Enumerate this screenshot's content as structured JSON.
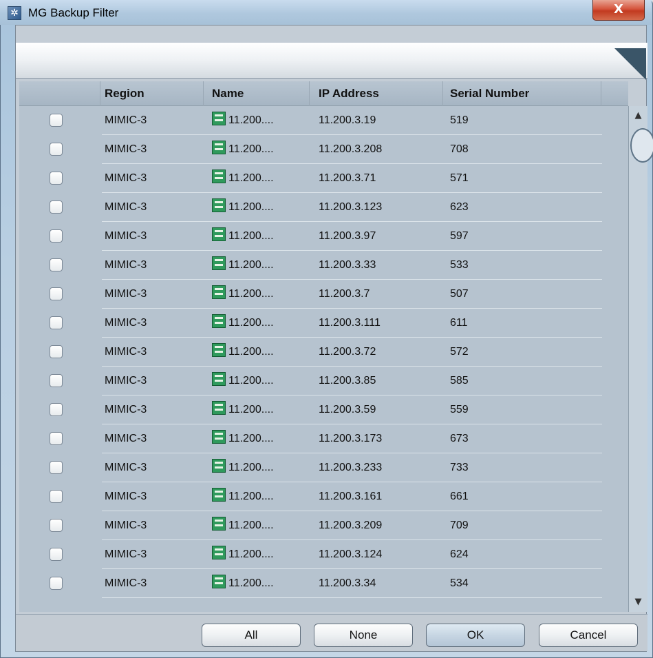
{
  "window": {
    "title": "MG Backup Filter",
    "close_label": "X"
  },
  "table": {
    "columns": [
      "Region",
      "Name",
      "IP Address",
      "Serial Number"
    ],
    "rows": [
      {
        "region": "MIMIC-3",
        "name": "11.200....",
        "ip": "11.200.3.19",
        "serial": "519"
      },
      {
        "region": "MIMIC-3",
        "name": "11.200....",
        "ip": "11.200.3.208",
        "serial": "708"
      },
      {
        "region": "MIMIC-3",
        "name": "11.200....",
        "ip": "11.200.3.71",
        "serial": "571"
      },
      {
        "region": "MIMIC-3",
        "name": "11.200....",
        "ip": "11.200.3.123",
        "serial": "623"
      },
      {
        "region": "MIMIC-3",
        "name": "11.200....",
        "ip": "11.200.3.97",
        "serial": "597"
      },
      {
        "region": "MIMIC-3",
        "name": "11.200....",
        "ip": "11.200.3.33",
        "serial": "533"
      },
      {
        "region": "MIMIC-3",
        "name": "11.200....",
        "ip": "11.200.3.7",
        "serial": "507"
      },
      {
        "region": "MIMIC-3",
        "name": "11.200....",
        "ip": "11.200.3.111",
        "serial": "611"
      },
      {
        "region": "MIMIC-3",
        "name": "11.200....",
        "ip": "11.200.3.72",
        "serial": "572"
      },
      {
        "region": "MIMIC-3",
        "name": "11.200....",
        "ip": "11.200.3.85",
        "serial": "585"
      },
      {
        "region": "MIMIC-3",
        "name": "11.200....",
        "ip": "11.200.3.59",
        "serial": "559"
      },
      {
        "region": "MIMIC-3",
        "name": "11.200....",
        "ip": "11.200.3.173",
        "serial": "673"
      },
      {
        "region": "MIMIC-3",
        "name": "11.200....",
        "ip": "11.200.3.233",
        "serial": "733"
      },
      {
        "region": "MIMIC-3",
        "name": "11.200....",
        "ip": "11.200.3.161",
        "serial": "661"
      },
      {
        "region": "MIMIC-3",
        "name": "11.200....",
        "ip": "11.200.3.209",
        "serial": "709"
      },
      {
        "region": "MIMIC-3",
        "name": "11.200....",
        "ip": "11.200.3.124",
        "serial": "624"
      },
      {
        "region": "MIMIC-3",
        "name": "11.200....",
        "ip": "11.200.3.34",
        "serial": "534"
      }
    ],
    "row_icon": "network-device-icon"
  },
  "scrollbar": {
    "up_glyph": "▲",
    "down_glyph": "▼"
  },
  "buttons": {
    "all": "All",
    "none": "None",
    "ok": "OK",
    "cancel": "Cancel"
  },
  "colors": {
    "table_bg": "#b6c3cf",
    "device_icon": "#2f9a5c",
    "close_button": "#c23a20"
  }
}
